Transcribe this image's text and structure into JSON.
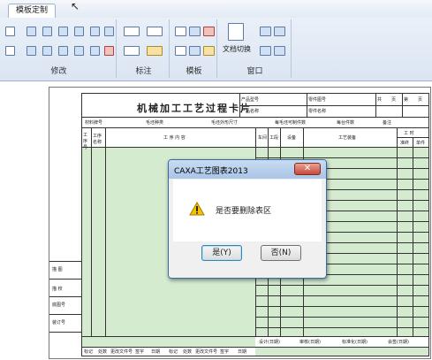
{
  "ribbon": {
    "tab_label": "模板定制",
    "groups": {
      "modify": "修改",
      "annotate": "标注",
      "template": "模板",
      "window": "窗口"
    },
    "doc_switch_label": "文档切换"
  },
  "form": {
    "title": "机械加工工艺过程卡片",
    "header_cells": [
      "产品型号",
      "产品名称",
      "零件图号",
      "零件名称",
      "共",
      "页",
      "第",
      "页"
    ],
    "row2_cells": [
      "材料牌号",
      "毛坯种类",
      "毛坯外形尺寸",
      "每毛坯可制件数",
      "每台件数",
      "备注"
    ],
    "col_heads": [
      "工序号",
      "工序名称",
      "工 序 内 容",
      "车间",
      "工段",
      "设备",
      "工艺装备",
      "工 时"
    ],
    "time_sub": [
      "准终",
      "单件"
    ],
    "left_labels": [
      "描 图",
      "描 校",
      "底图号",
      "装订号"
    ],
    "sign_cells": [
      "设计(日期)",
      "审核(日期)",
      "标准化(日期)",
      "会签(日期)"
    ],
    "bottom_cells": [
      "标记",
      "处数",
      "更改文件号",
      "签字",
      "日期",
      "标记",
      "处数",
      "更改文件号",
      "签字",
      "日期"
    ]
  },
  "dialog": {
    "title": "CAXA工艺图表2013",
    "message": "是否要删除表区",
    "yes_label": "是(Y)",
    "no_label": "否(N)",
    "close_label": "✕"
  },
  "colors": {
    "form_fill": "#d4ebd0",
    "ribbon_bg": "#dbe5f2"
  }
}
